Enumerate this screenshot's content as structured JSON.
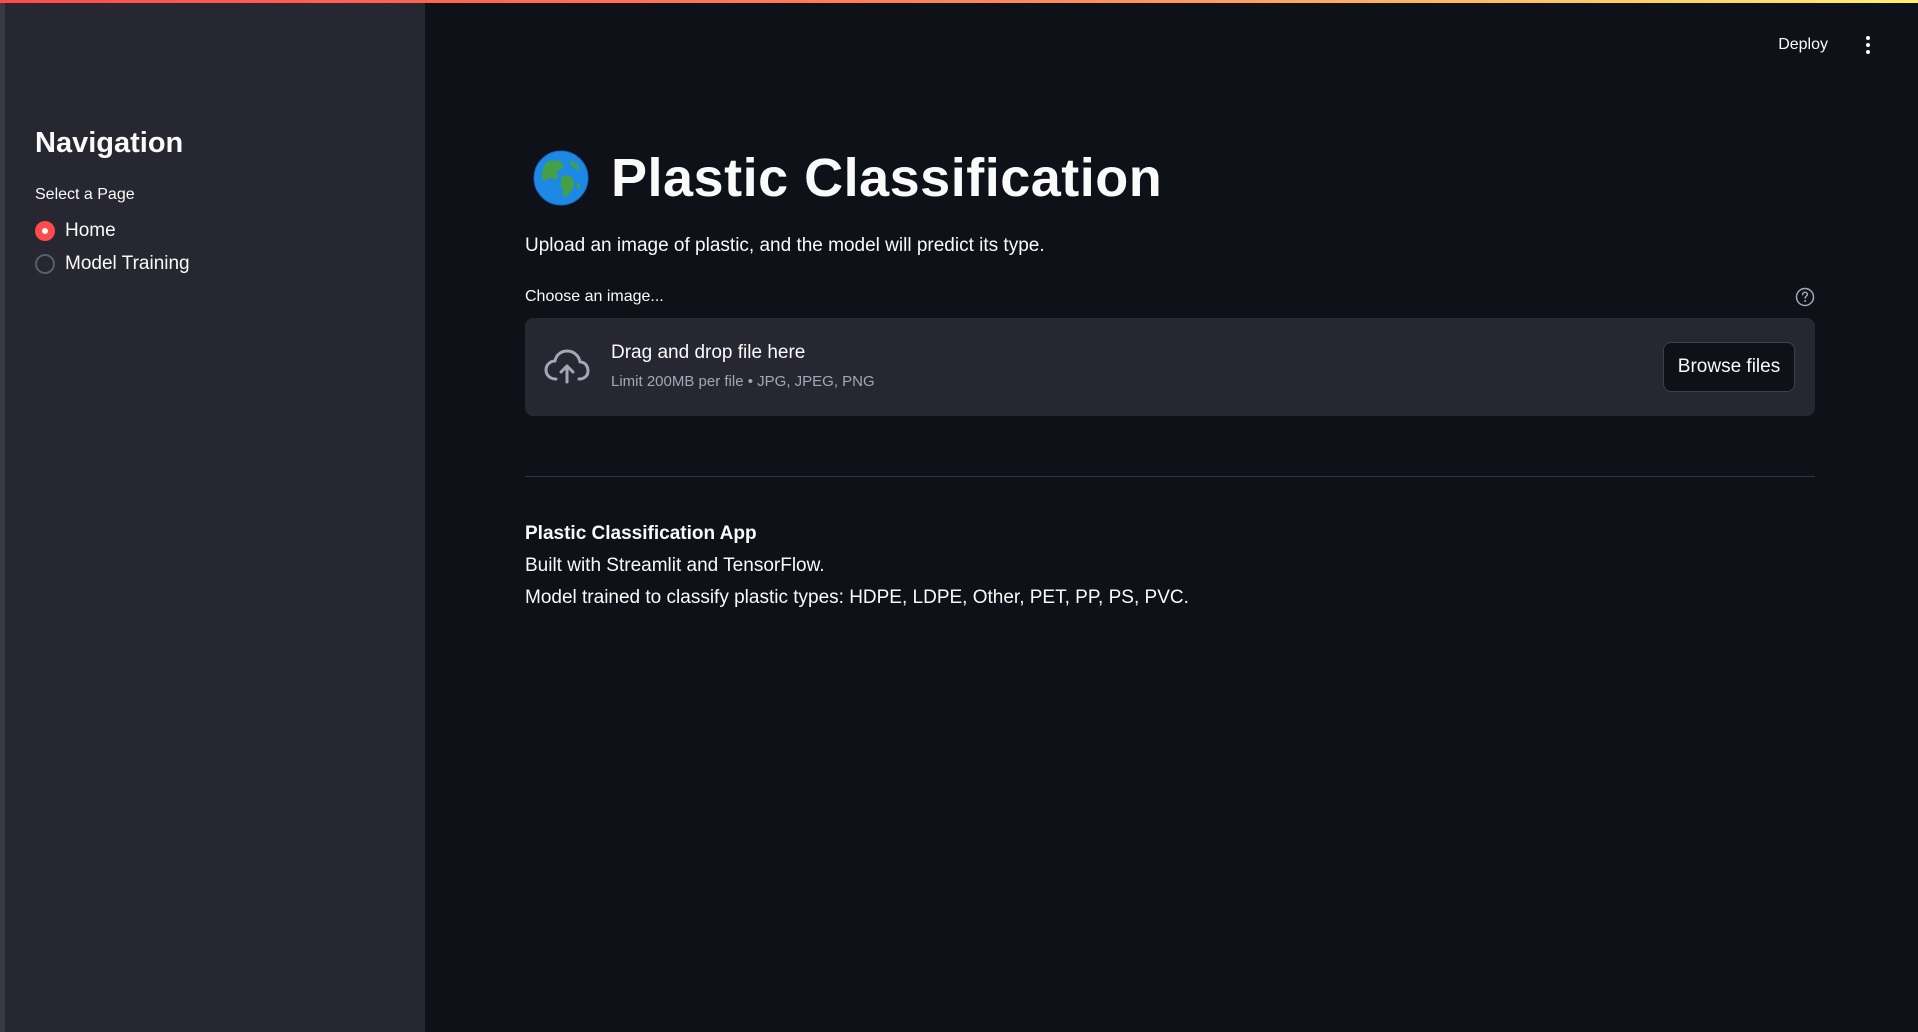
{
  "colors": {
    "accent": "#ff4b4b",
    "background": "#0e1117",
    "sidebar": "#262730",
    "text": "#fafafa",
    "muted": "#a3a8b8"
  },
  "header": {
    "deploy_label": "Deploy",
    "menu_icon": "kebab-menu-icon"
  },
  "sidebar": {
    "title": "Navigation",
    "select_label": "Select a Page",
    "options": [
      {
        "label": "Home",
        "selected": true
      },
      {
        "label": "Model Training",
        "selected": false
      }
    ]
  },
  "main": {
    "title_icon": "globe-icon",
    "title": "Plastic Classification",
    "subtitle": "Upload an image of plastic, and the model will predict its type.",
    "uploader": {
      "label": "Choose an image...",
      "help_icon": "help-circle-icon",
      "upload_icon": "cloud-upload-icon",
      "drop_text": "Drag and drop file here",
      "limit_text": "Limit 200MB per file • JPG, JPEG, PNG",
      "browse_label": "Browse files"
    },
    "footer": {
      "title": "Plastic Classification App",
      "line1": "Built with Streamlit and TensorFlow.",
      "line2": "Model trained to classify plastic types: HDPE, LDPE, Other, PET, PP, PS, PVC."
    }
  }
}
